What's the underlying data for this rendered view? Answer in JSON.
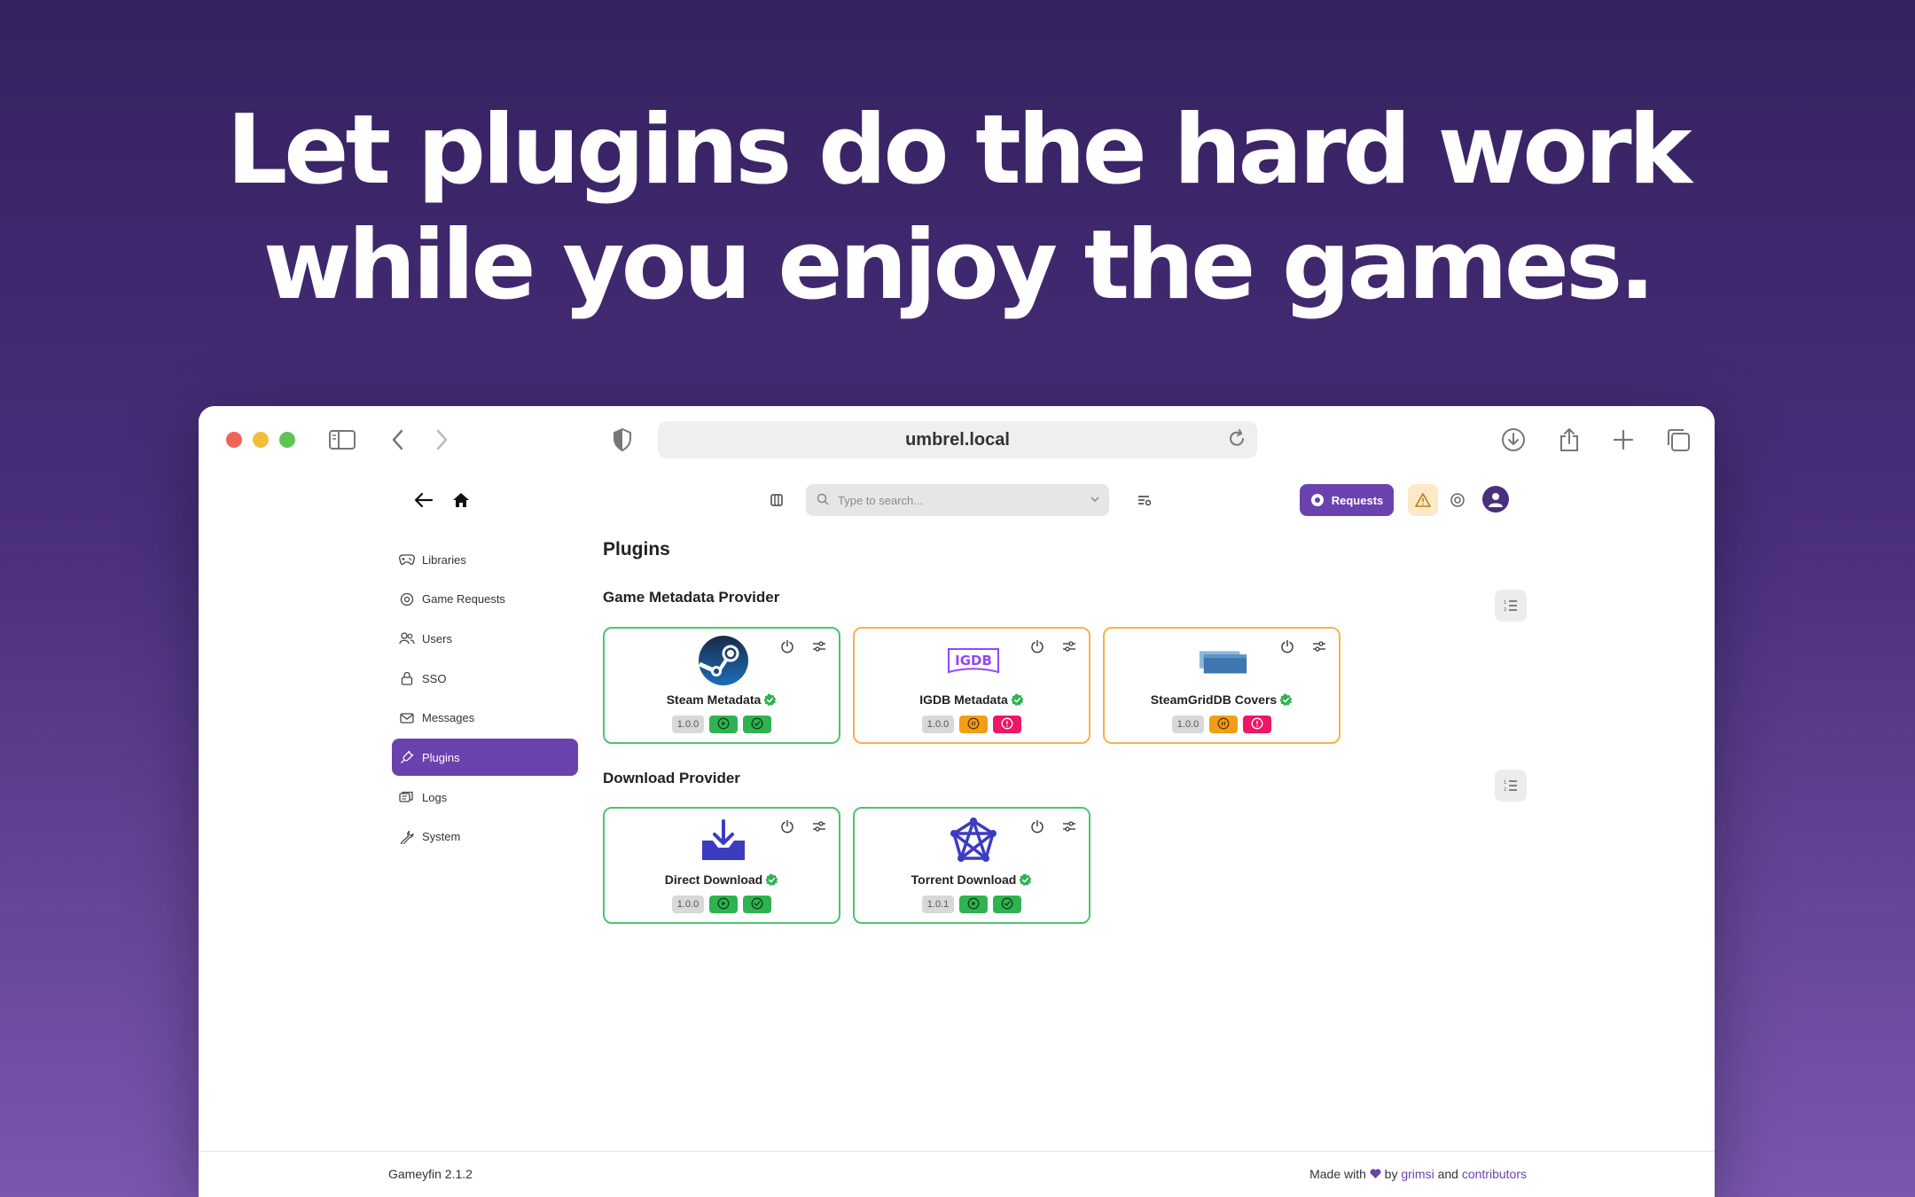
{
  "hero": {
    "line1": "Let plugins do the hard work",
    "line2": "while you enjoy the games."
  },
  "browser": {
    "url": "umbrel.local",
    "toolbar_icons": [
      "sidebar-icon",
      "back-chevron-icon",
      "forward-chevron-icon",
      "shield-icon",
      "reload-icon",
      "download-icon",
      "share-icon",
      "plus-icon",
      "tabs-icon"
    ]
  },
  "app": {
    "search_placeholder": "Type to search...",
    "requests_label": "Requests",
    "sidebar": [
      {
        "label": "Libraries",
        "icon": "gamepad-icon"
      },
      {
        "label": "Game Requests",
        "icon": "request-icon"
      },
      {
        "label": "Users",
        "icon": "users-icon"
      },
      {
        "label": "SSO",
        "icon": "lock-icon"
      },
      {
        "label": "Messages",
        "icon": "mail-icon"
      },
      {
        "label": "Plugins",
        "icon": "plug-icon",
        "active": true
      },
      {
        "label": "Logs",
        "icon": "logs-icon"
      },
      {
        "label": "System",
        "icon": "wrench-icon"
      }
    ],
    "page_title": "Plugins",
    "sections": [
      {
        "title": "Game Metadata Provider",
        "plugins": [
          {
            "name": "Steam Metadata",
            "version": "1.0.0",
            "logo": "steam-logo-icon",
            "status": "ok"
          },
          {
            "name": "IGDB Metadata",
            "version": "1.0.0",
            "logo": "igdb-logo-icon",
            "logo_text": "IGDB",
            "status": "warn"
          },
          {
            "name": "SteamGridDB Covers",
            "version": "1.0.0",
            "logo": "steamgriddb-logo-icon",
            "status": "warn"
          }
        ]
      },
      {
        "title": "Download Provider",
        "plugins": [
          {
            "name": "Direct Download",
            "version": "1.0.0",
            "logo": "direct-download-logo-icon",
            "status": "ok"
          },
          {
            "name": "Torrent Download",
            "version": "1.0.1",
            "logo": "torrent-logo-icon",
            "status": "ok"
          }
        ]
      }
    ],
    "colors": {
      "accent": "#6a42ad",
      "ok": "#2fb350",
      "warn": "#f29e16",
      "error": "#ee1667"
    }
  },
  "footer": {
    "version": "Gameyfin 2.1.2",
    "made_with": "Made with",
    "by": "by",
    "author": "grimsi",
    "and": "and",
    "contributors": "contributors"
  }
}
